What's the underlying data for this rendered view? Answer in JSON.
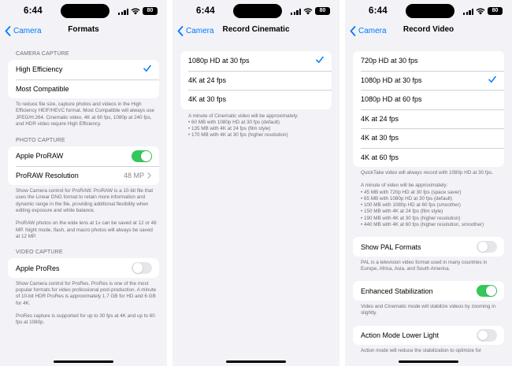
{
  "status_bar": {
    "time": "6:44",
    "battery": "80"
  },
  "colors": {
    "accent": "#007aff",
    "toggle_on": "#34c759",
    "toggle_off": "#e6e6ea",
    "background": "#f2f2f7"
  },
  "screens": {
    "formats": {
      "back_label": "Camera",
      "title": "Formats",
      "camera_capture": {
        "header": "CAMERA CAPTURE",
        "options": [
          "High Efficiency",
          "Most Compatible"
        ],
        "selected": "High Efficiency",
        "footer": "To reduce file size, capture photos and videos in the High Efficiency HEIF/HEVC format. Most Compatible will always use JPEG/H.264. Cinematic video, 4K at 60 fps, 1080p at 240 fps, and HDR video require High Efficiency."
      },
      "photo_capture": {
        "header": "PHOTO CAPTURE",
        "proraw_label": "Apple ProRAW",
        "proraw_on": true,
        "resolution_label": "ProRAW Resolution",
        "resolution_value": "48 MP",
        "footer_1": "Show Camera control for ProRAW. ProRAW is a 10-bit file that uses the Linear DNG format to retain more information and dynamic range in the file, providing additional flexibility when editing exposure and white balance.",
        "footer_2": "ProRAW photos on the wide lens at 1x can be saved at 12 or 48 MP. Night mode, flash, and macro photos will always be saved at 12 MP."
      },
      "video_capture": {
        "header": "VIDEO CAPTURE",
        "prores_label": "Apple ProRes",
        "prores_on": false,
        "footer_1": "Show Camera control for ProRes. ProRes is one of the most popular formats for video professional post-production. A minute of 10-bit HDR ProRes is approximately 1.7 GB for HD and 6 GB for 4K.",
        "footer_2": "ProRes capture is supported for up to 30 fps at 4K and up to 60 fps at 1080p."
      }
    },
    "record_cinematic": {
      "back_label": "Camera",
      "title": "Record Cinematic",
      "options": [
        "1080p HD at 30 fps",
        "4K at 24 fps",
        "4K at 30 fps"
      ],
      "selected": "1080p HD at 30 fps",
      "footer_lines": [
        "A minute of Cinematic video will be approximately:",
        "• 60 MB with 1080p HD at 30 fps (default)",
        "• 135 MB with 4K at 24 fps (film style)",
        "• 170 MB with 4K at 30 fps (higher resolution)"
      ]
    },
    "record_video": {
      "back_label": "Camera",
      "title": "Record Video",
      "options": [
        "720p HD at 30 fps",
        "1080p HD at 30 fps",
        "1080p HD at 60 fps",
        "4K at 24 fps",
        "4K at 30 fps",
        "4K at 60 fps"
      ],
      "selected": "1080p HD at 30 fps",
      "quicktake_note": "QuickTake video will always record with 1080p HD at 30 fps.",
      "size_lines": [
        "A minute of video will be approximately:",
        "• 45 MB with 720p HD at 30 fps (space saver)",
        "• 65 MB with 1080p HD at 30 fps (default)",
        "• 100 MB with 1080p HD at 60 fps (smoother)",
        "• 150 MB with 4K at 24 fps (film style)",
        "• 190 MB with 4K at 30 fps (higher resolution)",
        "• 440 MB with 4K at 60 fps (higher resolution, smoother)"
      ],
      "pal": {
        "label": "Show PAL Formats",
        "on": false,
        "footer": "PAL is a television video format used in many countries in Europe, Africa, Asia, and South America."
      },
      "stabilization": {
        "label": "Enhanced Stabilization",
        "on": true,
        "footer": "Video and Cinematic mode will stabilize videos by zooming in slightly."
      },
      "action_mode": {
        "label": "Action Mode Lower Light",
        "on": false,
        "footer": "Action mode will reduce the stabilization to optimize for"
      }
    }
  }
}
